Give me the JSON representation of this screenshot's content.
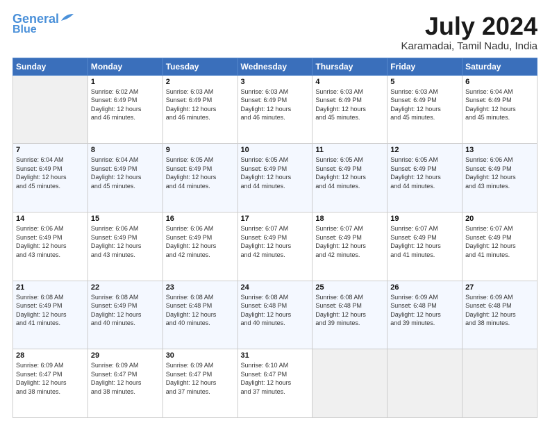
{
  "logo": {
    "line1": "General",
    "line2": "Blue"
  },
  "title": "July 2024",
  "subtitle": "Karamadai, Tamil Nadu, India",
  "headers": [
    "Sunday",
    "Monday",
    "Tuesday",
    "Wednesday",
    "Thursday",
    "Friday",
    "Saturday"
  ],
  "weeks": [
    [
      {
        "day": "",
        "info": ""
      },
      {
        "day": "1",
        "info": "Sunrise: 6:02 AM\nSunset: 6:49 PM\nDaylight: 12 hours\nand 46 minutes."
      },
      {
        "day": "2",
        "info": "Sunrise: 6:03 AM\nSunset: 6:49 PM\nDaylight: 12 hours\nand 46 minutes."
      },
      {
        "day": "3",
        "info": "Sunrise: 6:03 AM\nSunset: 6:49 PM\nDaylight: 12 hours\nand 46 minutes."
      },
      {
        "day": "4",
        "info": "Sunrise: 6:03 AM\nSunset: 6:49 PM\nDaylight: 12 hours\nand 45 minutes."
      },
      {
        "day": "5",
        "info": "Sunrise: 6:03 AM\nSunset: 6:49 PM\nDaylight: 12 hours\nand 45 minutes."
      },
      {
        "day": "6",
        "info": "Sunrise: 6:04 AM\nSunset: 6:49 PM\nDaylight: 12 hours\nand 45 minutes."
      }
    ],
    [
      {
        "day": "7",
        "info": "Sunrise: 6:04 AM\nSunset: 6:49 PM\nDaylight: 12 hours\nand 45 minutes."
      },
      {
        "day": "8",
        "info": "Sunrise: 6:04 AM\nSunset: 6:49 PM\nDaylight: 12 hours\nand 45 minutes."
      },
      {
        "day": "9",
        "info": "Sunrise: 6:05 AM\nSunset: 6:49 PM\nDaylight: 12 hours\nand 44 minutes."
      },
      {
        "day": "10",
        "info": "Sunrise: 6:05 AM\nSunset: 6:49 PM\nDaylight: 12 hours\nand 44 minutes."
      },
      {
        "day": "11",
        "info": "Sunrise: 6:05 AM\nSunset: 6:49 PM\nDaylight: 12 hours\nand 44 minutes."
      },
      {
        "day": "12",
        "info": "Sunrise: 6:05 AM\nSunset: 6:49 PM\nDaylight: 12 hours\nand 44 minutes."
      },
      {
        "day": "13",
        "info": "Sunrise: 6:06 AM\nSunset: 6:49 PM\nDaylight: 12 hours\nand 43 minutes."
      }
    ],
    [
      {
        "day": "14",
        "info": "Sunrise: 6:06 AM\nSunset: 6:49 PM\nDaylight: 12 hours\nand 43 minutes."
      },
      {
        "day": "15",
        "info": "Sunrise: 6:06 AM\nSunset: 6:49 PM\nDaylight: 12 hours\nand 43 minutes."
      },
      {
        "day": "16",
        "info": "Sunrise: 6:06 AM\nSunset: 6:49 PM\nDaylight: 12 hours\nand 42 minutes."
      },
      {
        "day": "17",
        "info": "Sunrise: 6:07 AM\nSunset: 6:49 PM\nDaylight: 12 hours\nand 42 minutes."
      },
      {
        "day": "18",
        "info": "Sunrise: 6:07 AM\nSunset: 6:49 PM\nDaylight: 12 hours\nand 42 minutes."
      },
      {
        "day": "19",
        "info": "Sunrise: 6:07 AM\nSunset: 6:49 PM\nDaylight: 12 hours\nand 41 minutes."
      },
      {
        "day": "20",
        "info": "Sunrise: 6:07 AM\nSunset: 6:49 PM\nDaylight: 12 hours\nand 41 minutes."
      }
    ],
    [
      {
        "day": "21",
        "info": "Sunrise: 6:08 AM\nSunset: 6:49 PM\nDaylight: 12 hours\nand 41 minutes."
      },
      {
        "day": "22",
        "info": "Sunrise: 6:08 AM\nSunset: 6:49 PM\nDaylight: 12 hours\nand 40 minutes."
      },
      {
        "day": "23",
        "info": "Sunrise: 6:08 AM\nSunset: 6:48 PM\nDaylight: 12 hours\nand 40 minutes."
      },
      {
        "day": "24",
        "info": "Sunrise: 6:08 AM\nSunset: 6:48 PM\nDaylight: 12 hours\nand 40 minutes."
      },
      {
        "day": "25",
        "info": "Sunrise: 6:08 AM\nSunset: 6:48 PM\nDaylight: 12 hours\nand 39 minutes."
      },
      {
        "day": "26",
        "info": "Sunrise: 6:09 AM\nSunset: 6:48 PM\nDaylight: 12 hours\nand 39 minutes."
      },
      {
        "day": "27",
        "info": "Sunrise: 6:09 AM\nSunset: 6:48 PM\nDaylight: 12 hours\nand 38 minutes."
      }
    ],
    [
      {
        "day": "28",
        "info": "Sunrise: 6:09 AM\nSunset: 6:47 PM\nDaylight: 12 hours\nand 38 minutes."
      },
      {
        "day": "29",
        "info": "Sunrise: 6:09 AM\nSunset: 6:47 PM\nDaylight: 12 hours\nand 38 minutes."
      },
      {
        "day": "30",
        "info": "Sunrise: 6:09 AM\nSunset: 6:47 PM\nDaylight: 12 hours\nand 37 minutes."
      },
      {
        "day": "31",
        "info": "Sunrise: 6:10 AM\nSunset: 6:47 PM\nDaylight: 12 hours\nand 37 minutes."
      },
      {
        "day": "",
        "info": ""
      },
      {
        "day": "",
        "info": ""
      },
      {
        "day": "",
        "info": ""
      }
    ]
  ]
}
